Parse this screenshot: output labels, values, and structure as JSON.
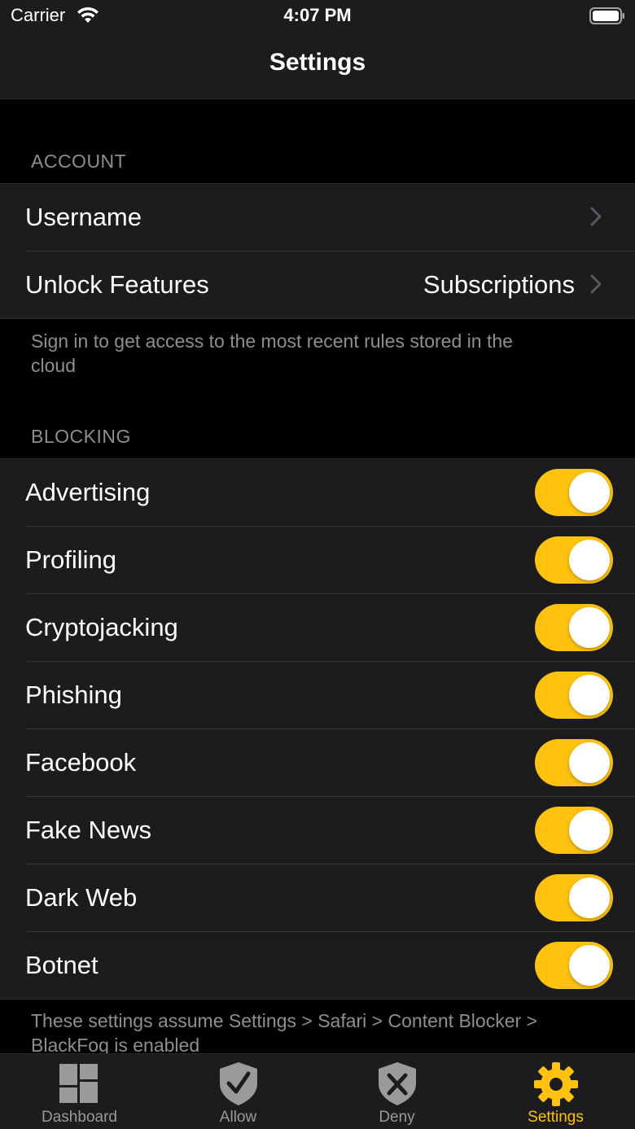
{
  "status_bar": {
    "carrier": "Carrier",
    "time": "4:07 PM"
  },
  "nav": {
    "title": "Settings"
  },
  "account": {
    "header": "ACCOUNT",
    "rows": [
      {
        "label": "Username",
        "value": ""
      },
      {
        "label": "Unlock Features",
        "value": "Subscriptions"
      }
    ],
    "footer": "Sign in to get access to the most recent rules stored in the cloud"
  },
  "blocking": {
    "header": "BLOCKING",
    "rows": [
      {
        "label": "Advertising",
        "on": true
      },
      {
        "label": "Profiling",
        "on": true
      },
      {
        "label": "Cryptojacking",
        "on": true
      },
      {
        "label": "Phishing",
        "on": true
      },
      {
        "label": "Facebook",
        "on": true
      },
      {
        "label": "Fake News",
        "on": true
      },
      {
        "label": "Dark Web",
        "on": true
      },
      {
        "label": "Botnet",
        "on": true
      }
    ],
    "footer": "These settings assume Settings > Safari > Content Blocker > BlackFog is enabled"
  },
  "tabbar": {
    "tabs": [
      {
        "label": "Dashboard",
        "icon": "dashboard-icon",
        "active": false
      },
      {
        "label": "Allow",
        "icon": "shield-check-icon",
        "active": false
      },
      {
        "label": "Deny",
        "icon": "shield-x-icon",
        "active": false
      },
      {
        "label": "Settings",
        "icon": "gear-icon",
        "active": true
      }
    ]
  },
  "colors": {
    "accent": "#ffc20e",
    "background": "#000000",
    "cell": "#1c1c1e",
    "secondary_text": "#8e8e93"
  }
}
